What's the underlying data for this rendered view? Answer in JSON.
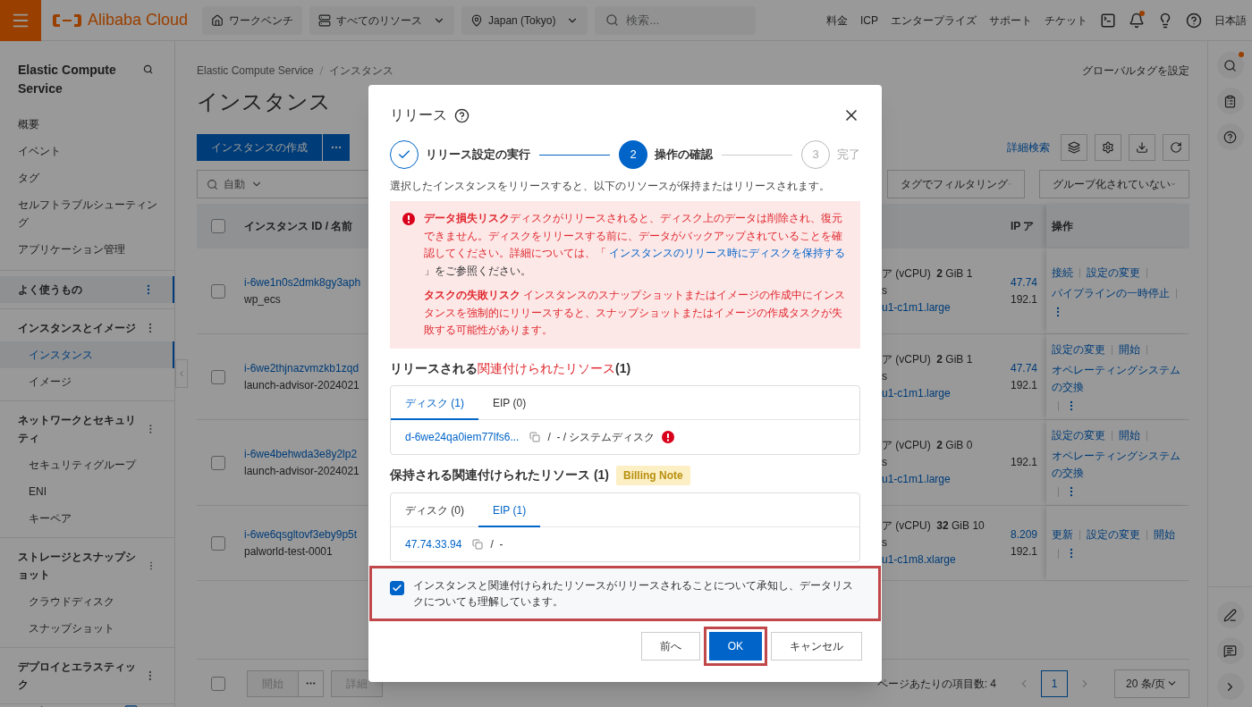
{
  "topbar": {
    "brand": "Alibaba Cloud",
    "nav": [
      {
        "kind": "home",
        "label": "ワークベンチ",
        "dropdown": false
      },
      {
        "kind": "resources",
        "label": "すべてのリソース",
        "dropdown": true
      },
      {
        "kind": "region",
        "label": "Japan (Tokyo)",
        "dropdown": true
      }
    ],
    "search": {
      "placeholder": "検索..."
    },
    "links": [
      "料金",
      "ICP",
      "エンタープライズ",
      "サポート",
      "チケット"
    ],
    "tools": [
      {
        "kind": "terminal",
        "badge": false
      },
      {
        "kind": "bell",
        "badge": true
      },
      {
        "kind": "bulb",
        "badge": false
      },
      {
        "kind": "help",
        "badge": false
      }
    ],
    "language": "日本語"
  },
  "sidebar": {
    "title": "Elastic Compute Service",
    "items": [
      {
        "label": "概要",
        "selected": false
      },
      {
        "label": "イベント",
        "selected": false
      },
      {
        "label": "タグ",
        "selected": false
      },
      {
        "label": "セルフトラブルシューティング",
        "selected": false
      },
      {
        "label": "アプリケーション管理",
        "selected": false
      }
    ],
    "groups": [
      {
        "label": "よく使うもの",
        "highlighted": true
      },
      {
        "label": "インスタンスとイメージ",
        "highlighted": false,
        "children": [
          {
            "label": "インスタンス",
            "selected": true
          },
          {
            "label": "イメージ",
            "selected": false
          }
        ]
      },
      {
        "label": "ネットワークとセキュリティ",
        "highlighted": false,
        "children": [
          {
            "label": "セキュリティグループ",
            "selected": false
          },
          {
            "label": "ENI",
            "selected": false
          },
          {
            "label": "キーペア",
            "selected": false
          }
        ]
      },
      {
        "label": "ストレージとスナップショット",
        "highlighted": false,
        "children": [
          {
            "label": "クラウドディスク",
            "selected": false
          },
          {
            "label": "スナップショット",
            "selected": false
          }
        ]
      },
      {
        "label": "デプロイとエラスティック",
        "highlighted": false
      }
    ]
  },
  "main": {
    "breadcrumb": [
      "Elastic Compute Service",
      "インスタンス"
    ],
    "global_tag": "グローバルタグを設定",
    "title": "インスタンス",
    "create_button": "インスタンスの作成",
    "advanced_search": "詳細検索",
    "tools": [
      {
        "kind": "layers"
      },
      {
        "kind": "settings"
      },
      {
        "kind": "download"
      },
      {
        "kind": "refresh"
      }
    ],
    "search_mode": "自動",
    "filters": [
      "タグでフィルタリング",
      "グループ化されていない"
    ],
    "table": {
      "header_checked": false,
      "columns": [
        "インスタンス ID / 名前",
        "IP ア",
        "操作"
      ],
      "rows": [
        {
          "checked": false,
          "id": "i-6we1n0s2dmk8gy3aph",
          "name": "wp_ecs",
          "spec": "ア (vCPU)  **2** GiB 1",
          "spec_2": "s",
          "type": "u1-c1m1.large",
          "ips": [
            "47.74",
            "192.1"
          ],
          "actions": [
            "接続",
            "設定の変更",
            "パイプラインの一時停止"
          ]
        },
        {
          "checked": false,
          "id": "i-6we2thjnazvmzkb1zqd",
          "name": "launch-advisor-2024021",
          "spec": "ア (vCPU)  **2** GiB 1",
          "spec_2": "s",
          "type": "u1-c1m1.large",
          "ips": [
            "47.74",
            "192.1"
          ],
          "actions": [
            "設定の変更",
            "開始",
            "オペレーティングシステムの交換"
          ]
        },
        {
          "checked": false,
          "id": "i-6we4behwda3e8y2lp2",
          "name": "launch-advisor-2024021",
          "spec": "ア (vCPU)  **2** GiB 0",
          "spec_2": "s",
          "type": "u1-c1m1.large",
          "ips": [
            "192.1"
          ],
          "actions": [
            "設定の変更",
            "開始",
            "オペレーティングシステムの交換"
          ]
        },
        {
          "checked": false,
          "id": "i-6we6qsgltovf3eby9p5t",
          "name": "palworld-test-0001",
          "spec": "ア (vCPU)  **32** GiB 10",
          "spec_2": "s",
          "type": "u1-c1m8.xlarge",
          "ips": [
            "8.209",
            "192.1"
          ],
          "actions": [
            "更新",
            "設定の変更",
            "開始"
          ]
        }
      ]
    },
    "footer": {
      "checked": false,
      "start": {
        "label": "開始",
        "disabled": true
      },
      "details": "詳細",
      "page_info": "ページあたりの項目数: 4",
      "pages": [
        {
          "label": "1",
          "selected": true
        }
      ],
      "page_size": "20 条/页"
    }
  },
  "rail": {
    "top": [
      {
        "kind": "search",
        "badge": true
      },
      {
        "kind": "checklist",
        "badge": false
      },
      {
        "kind": "help",
        "badge": false
      }
    ],
    "bottom": [
      {
        "kind": "edit",
        "badge": false
      },
      {
        "kind": "feedback",
        "badge": false
      },
      {
        "kind": "expand",
        "badge": false
      }
    ]
  },
  "dialog": {
    "title": "リリース",
    "steps": [
      {
        "label": "リリース設定の実行",
        "selected": false
      },
      {
        "number": "2",
        "label": "操作の確認",
        "selected": true
      },
      {
        "number": "3",
        "label": "完了",
        "selected": false
      }
    ],
    "intro": "選択したインスタンスをリリースすると、以下のリソースが保持またはリリースされます。",
    "alerts": [
      {
        "title": "データ損失リスク",
        "text": "ディスクがリリースされると、ディスク上のデータは削除され、復元できません。ディスクをリリースする前に、データがバックアップされていることを確認してください。詳細については、「 ",
        "link": "インスタンスのリリース時にディスクを保持する",
        "after": " 」をご参照ください。"
      },
      {
        "title": "タスクの失敗リスク",
        "text": " インスタンスのスナップショットまたはイメージの作成中にインスタンスを強制的にリリースすると、スナップショットまたはイメージの作成タスクが失敗する可能性があります。"
      }
    ],
    "sections": [
      {
        "title": "リリースされる",
        "highlight": "関連付けられたリソース",
        "count": "(1)",
        "tabs": [
          {
            "label": "ディスク (1)",
            "selected": true
          },
          {
            "label": "EIP (0)",
            "selected": false
          }
        ],
        "row": {
          "link": "d-6we24qa0iem77lfs6...",
          "text": "/  - / システムディスク",
          "warning": true
        }
      },
      {
        "title": "保持される関連付けられたリソース",
        "count": " (1)",
        "badge": "Billing Note",
        "tabs": [
          {
            "label": "ディスク (0)",
            "selected": false
          },
          {
            "label": "EIP (1)",
            "selected": true
          }
        ],
        "row": {
          "link": "47.74.33.94",
          "text": "/  -",
          "warning": false
        }
      }
    ],
    "acknowledge": {
      "text": "インスタンスと関連付けられたリソースがリリースされることについて承知し、データリスクについても理解しています。",
      "checked": true,
      "highlighted": true
    },
    "buttons": [
      {
        "label": "前へ",
        "kind": "default",
        "highlighted": false
      },
      {
        "label": "OK",
        "kind": "primary",
        "highlighted": true
      },
      {
        "label": "キャンセル",
        "kind": "default",
        "highlighted": false
      }
    ]
  }
}
